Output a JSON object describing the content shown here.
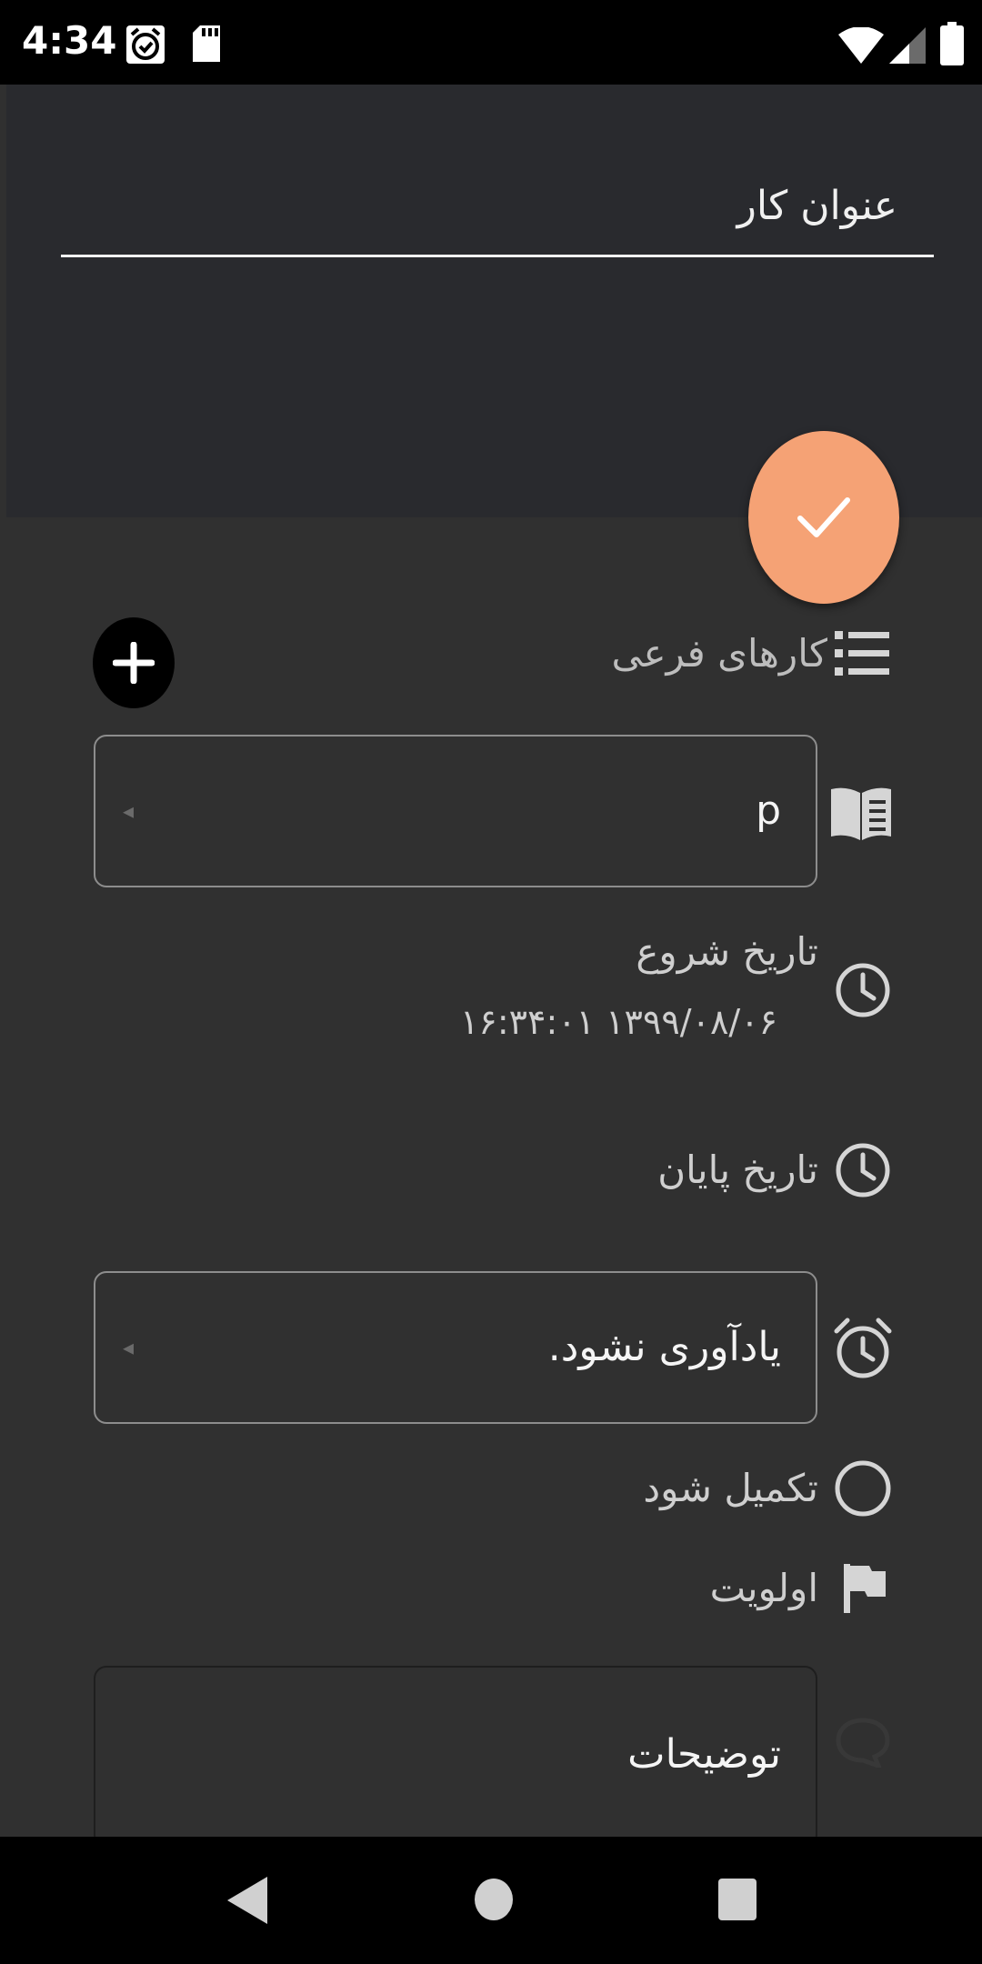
{
  "status_bar": {
    "time": "4:34",
    "icons": [
      "alarm-app-icon",
      "sd-card-icon",
      "wifi-icon",
      "signal-icon",
      "battery-icon"
    ]
  },
  "header": {
    "title_placeholder": "عنوان کار"
  },
  "fab": {
    "icon": "check-icon",
    "color": "#f5a275"
  },
  "subtasks": {
    "label": "کارهای فرعی",
    "icon": "list-icon",
    "add_icon": "plus-icon"
  },
  "category": {
    "value": "p",
    "icon": "book-icon"
  },
  "start_date": {
    "label": "تاریخ شروع",
    "value": "۱۶:۳۴:۰۱ ۱۳۹۹/۰۸/۰۶",
    "icon": "clock-icon"
  },
  "end_date": {
    "label": "تاریخ پایان",
    "icon": "clock-icon"
  },
  "reminder": {
    "value": "یادآوری نشود.",
    "icon": "alarm-icon"
  },
  "completed": {
    "label": "تکمیل شود",
    "icon": "circle-outline-icon"
  },
  "priority": {
    "label": "اولویت",
    "icon": "flag-icon"
  },
  "description": {
    "placeholder": "توضیحات",
    "icon": "comment-icon"
  },
  "nav_bar": {
    "icons": [
      "back-icon",
      "home-icon",
      "recents-icon"
    ]
  },
  "colors": {
    "background": "#303030",
    "header": "#292a2e",
    "accent": "#f5a275"
  }
}
